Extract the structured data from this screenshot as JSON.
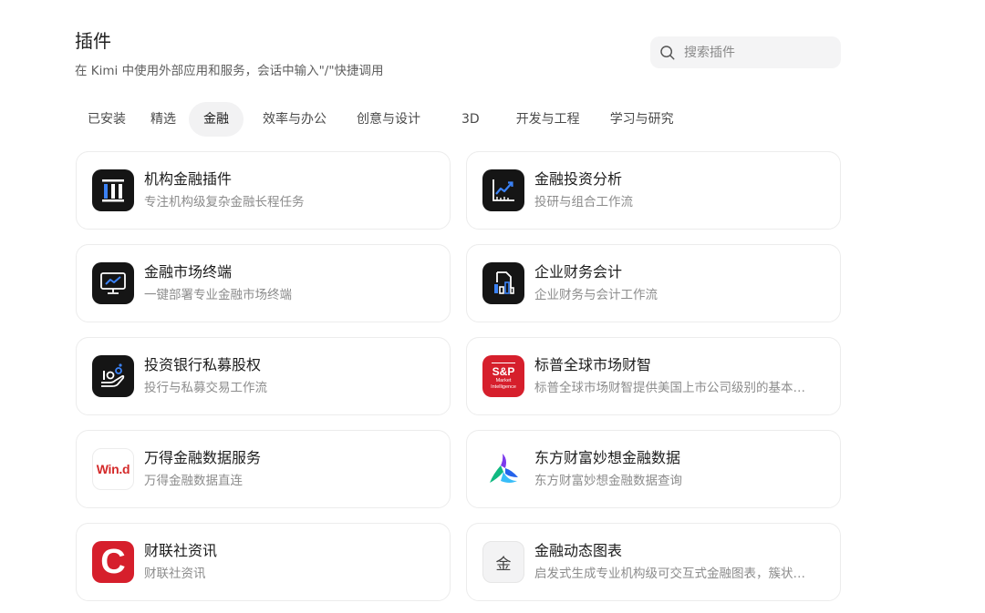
{
  "header": {
    "title": "插件",
    "subtitle": "在 Kimi 中使用外部应用和服务，会话中输入\"/\"快捷调用"
  },
  "search": {
    "placeholder": "搜索插件",
    "icon": "search-icon"
  },
  "tabs": [
    {
      "label": "已安装",
      "active": false
    },
    {
      "label": "精选",
      "active": false
    },
    {
      "label": "金融",
      "active": true
    },
    {
      "label": "效率与办公",
      "active": false
    },
    {
      "label": "创意与设计",
      "active": false
    },
    {
      "label": "3D",
      "active": false
    },
    {
      "label": "开发与工程",
      "active": false
    },
    {
      "label": "学习与研究",
      "active": false
    }
  ],
  "plugins": [
    {
      "title": "机构金融插件",
      "desc": "专注机构级复杂金融长程任务",
      "icon": "institution-columns-icon"
    },
    {
      "title": "金融投资分析",
      "desc": "投研与组合工作流",
      "icon": "chart-trend-icon"
    },
    {
      "title": "金融市场终端",
      "desc": "一键部署专业金融市场终端",
      "icon": "monitor-chart-icon"
    },
    {
      "title": "企业财务会计",
      "desc": "企业财务与会计工作流",
      "icon": "document-bars-icon"
    },
    {
      "title": "投资银行私募股权",
      "desc": "投行与私募交易工作流",
      "icon": "hand-coins-icon"
    },
    {
      "title": "标普全球市场财智",
      "desc": "标普全球市场财智提供美国上市公司级别的基本面和市场数据",
      "icon": "sp-logo",
      "logo_text": [
        "S&P",
        "Market",
        "Intelligence"
      ]
    },
    {
      "title": "万得金融数据服务",
      "desc": "万得金融数据直连",
      "icon": "wind-logo",
      "logo_text": [
        "Win.d"
      ]
    },
    {
      "title": "东方财富妙想金融数据",
      "desc": "东方财富妙想金融数据查询",
      "icon": "eastmoney-logo"
    },
    {
      "title": "财联社资讯",
      "desc": "财联社资讯",
      "icon": "cls-logo",
      "logo_text": [
        "C"
      ]
    },
    {
      "title": "金融动态图表",
      "desc": "启发式生成专业机构级可交互式金融图表，簇状图、折线图等",
      "icon": "gold-char-icon",
      "logo_text": [
        "金"
      ]
    }
  ],
  "colors": {
    "accent_blue": "#3b82f6",
    "red_brand": "#d61f2c",
    "active_tab_bg": "#f2f2f3"
  }
}
